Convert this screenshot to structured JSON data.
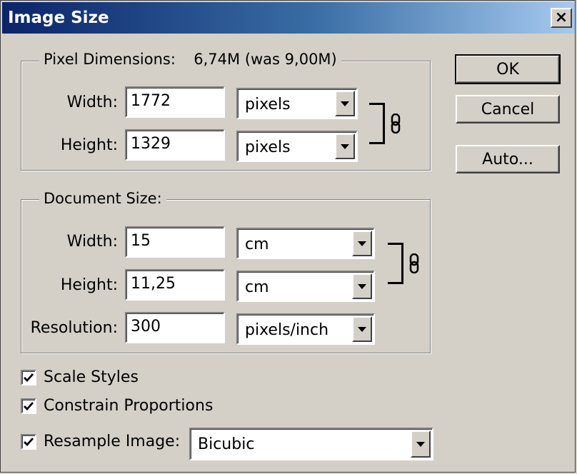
{
  "window": {
    "title": "Image Size",
    "close_glyph": "×"
  },
  "pixel_dimensions": {
    "legend": "Pixel Dimensions:",
    "size": "6,74M (was 9,00M)",
    "width_label": "Width:",
    "width_value": "1772",
    "width_unit": "pixels",
    "height_label": "Height:",
    "height_value": "1329",
    "height_unit": "pixels"
  },
  "document_size": {
    "legend": "Document Size:",
    "width_label": "Width:",
    "width_value": "15",
    "width_unit": "cm",
    "height_label": "Height:",
    "height_value": "11,25",
    "height_unit": "cm",
    "resolution_label": "Resolution:",
    "resolution_value": "300",
    "resolution_unit": "pixels/inch"
  },
  "options": {
    "scale_styles": {
      "label": "Scale Styles",
      "checked": true
    },
    "constrain_proportions": {
      "label": "Constrain Proportions",
      "checked": true
    },
    "resample_image": {
      "label": "Resample Image:",
      "checked": true,
      "method": "Bicubic"
    }
  },
  "buttons": {
    "ok": "OK",
    "cancel": "Cancel",
    "auto": "Auto..."
  },
  "icons": {
    "link": "chain-link-icon",
    "dropdown": "chevron-down-icon",
    "check": "checkmark-icon"
  }
}
